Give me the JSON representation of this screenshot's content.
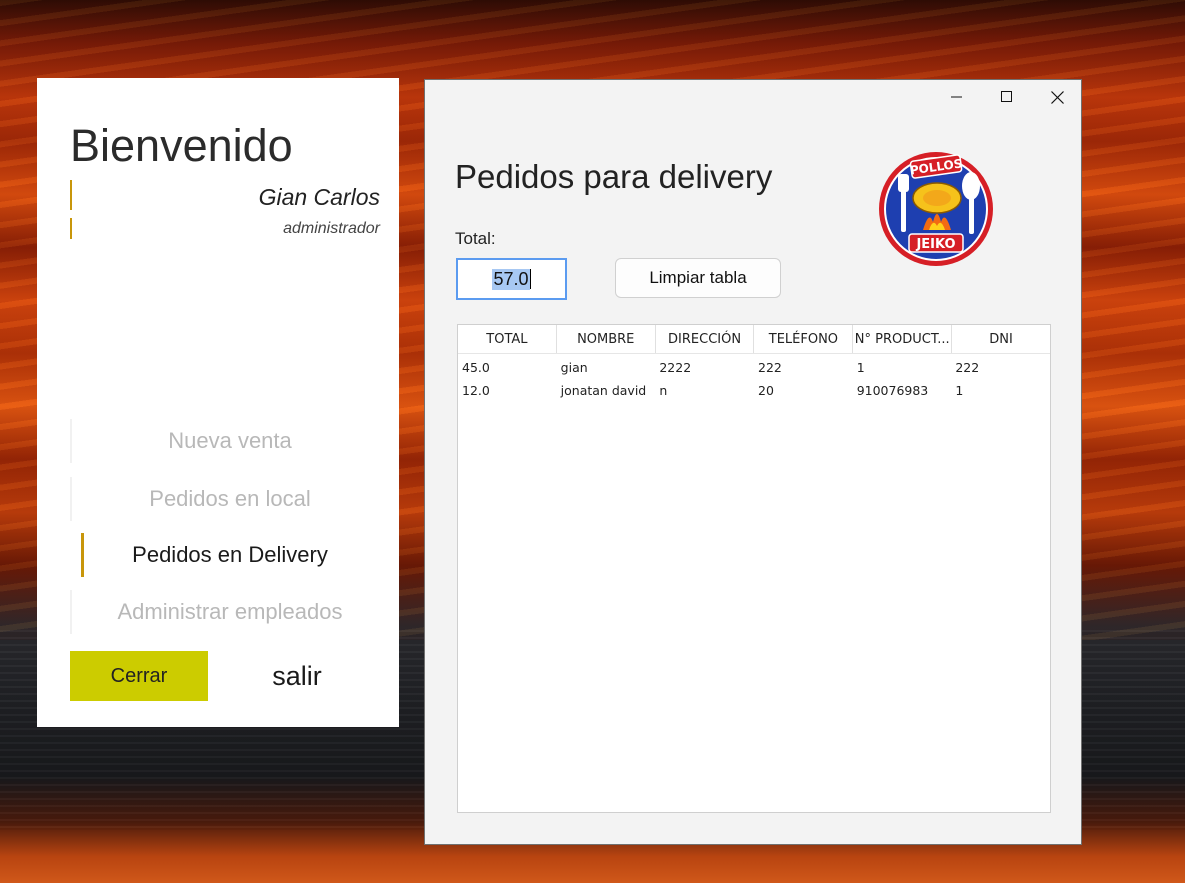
{
  "sidebar": {
    "welcome": "Bienvenido",
    "user_name": "Gian Carlos",
    "user_role": "administrador",
    "nav": [
      {
        "label": "Nueva venta",
        "active": false
      },
      {
        "label": "Pedidos en local",
        "active": false
      },
      {
        "label": "Pedidos en Delivery",
        "active": true
      },
      {
        "label": "Administrar empleados",
        "active": false
      }
    ],
    "close_label": "Cerrar",
    "exit_label": "salir"
  },
  "window": {
    "title": "Pedidos para delivery",
    "total_label": "Total:",
    "total_value": "57.0",
    "clear_button": "Limpiar tabla",
    "logo_top_text": "POLLOS",
    "logo_bottom_text": "JEIKO",
    "table": {
      "columns": [
        "TOTAL",
        "NOMBRE",
        "DIRECCIÓN",
        "TELÉFONO",
        "N° PRODUCT...",
        "DNI"
      ],
      "rows": [
        [
          "45.0",
          "gian",
          "2222",
          "222",
          "1",
          "222"
        ],
        [
          "12.0",
          "jonatan david",
          "n",
          "20",
          "910076983",
          "1"
        ]
      ]
    }
  },
  "colors": {
    "accent": "#c8960a",
    "close_button": "#cccc00",
    "input_focus": "#5b9bf0"
  }
}
